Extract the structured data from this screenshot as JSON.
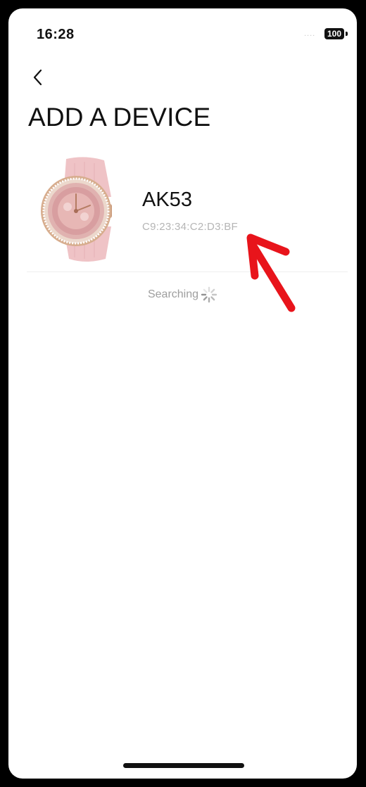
{
  "status_bar": {
    "time": "16:28",
    "signal": "....",
    "battery": "100"
  },
  "header": {
    "back_icon": "chevron-left-icon",
    "title": "ADD A DEVICE"
  },
  "device": {
    "name": "AK53",
    "mac": "C9:23:34:C2:D3:BF",
    "image": "pink-smartwatch-image"
  },
  "search": {
    "label": "Searching",
    "icon": "spinner-icon"
  },
  "annotation": {
    "icon": "red-arrow-icon",
    "color": "#e8141b"
  },
  "colors": {
    "background": "#ffffff",
    "text": "#111111",
    "muted_text": "#9e9e9e",
    "watch_band": "#efc3c6",
    "watch_case": "#d7ad8e"
  }
}
